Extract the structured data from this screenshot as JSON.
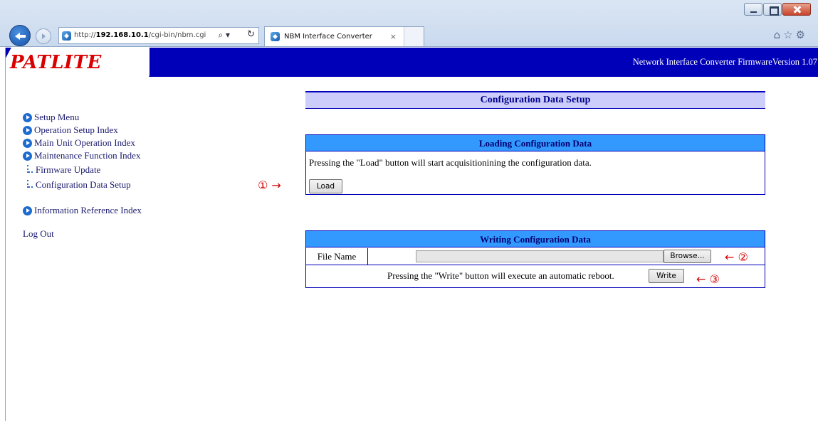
{
  "browser": {
    "url_prefix": "http://",
    "url_host": "192.168.10.1",
    "url_path": "/cgi-bin/nbm.cgi",
    "tab_title": "NBM Interface Converter",
    "tab_close": "×",
    "search_glyph": "⌕ ▾",
    "refresh_glyph": "↻",
    "tools_glyphs": "⌂☆⚙"
  },
  "header": {
    "logo": "PATLITE",
    "info": "Network Interface Converter   FirmwareVersion 1.07"
  },
  "menu": {
    "items": [
      {
        "label": "Setup Menu"
      },
      {
        "label": "Operation Setup Index"
      },
      {
        "label": "Main Unit Operation Index"
      },
      {
        "label": "Maintenance Function Index"
      }
    ],
    "subitems": [
      {
        "label": "Firmware Update"
      },
      {
        "label": "Configuration Data Setup"
      }
    ],
    "info_index": "Information Reference Index",
    "logout": "Log Out"
  },
  "main": {
    "title": "Configuration Data Setup",
    "loading": {
      "header": "Loading Configuration Data",
      "description": "Pressing the \"Load\" button will start acquisitionining the configuration data.",
      "load_button": "Load"
    },
    "writing": {
      "header": "Writing Configuration Data",
      "file_name_label": "File Name",
      "browse_button": "Browse...",
      "write_description": "Pressing the \"Write\" button will execute an automatic reboot.",
      "write_button": "Write"
    }
  },
  "annotations": {
    "a1": "① →",
    "a2": "← ②",
    "a3": "← ③"
  },
  "colors": {
    "header_blue": "#0000b8",
    "section_head": "#3399ff",
    "title_bg": "#cccdfa",
    "logo_red": "#d80000",
    "annotation_red": "#d40000"
  }
}
